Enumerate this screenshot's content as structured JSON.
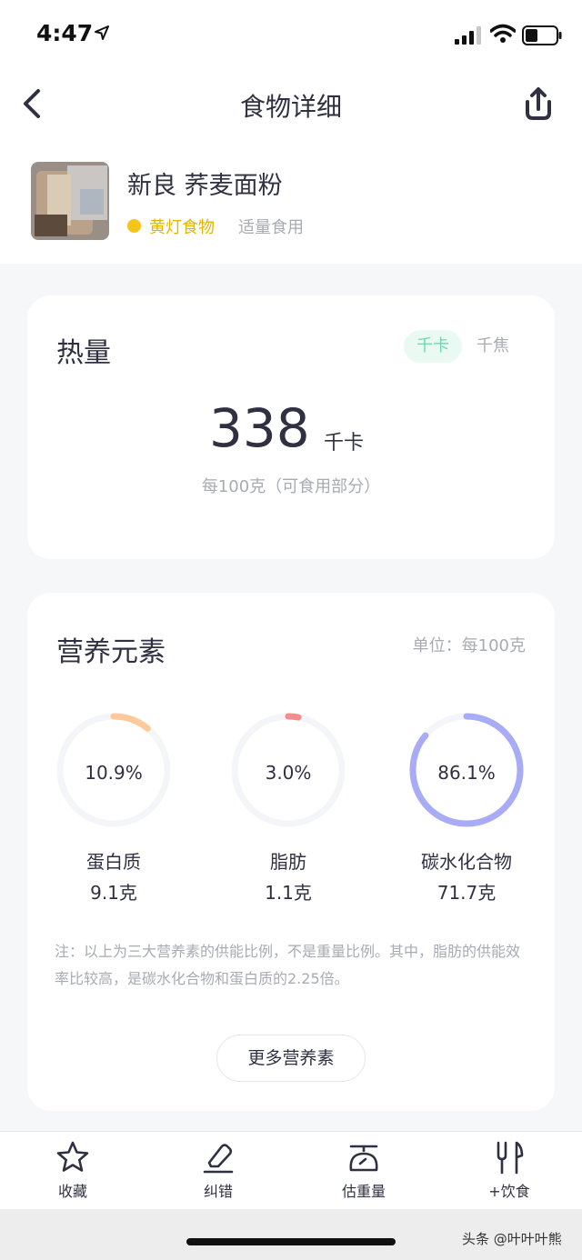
{
  "status": {
    "time": "4:47"
  },
  "nav": {
    "title": "食物详细"
  },
  "food": {
    "name": "新良 荞麦面粉",
    "light": "黄灯食物",
    "advice": "适量食用"
  },
  "energy": {
    "title": "热量",
    "unit_kcal": "千卡",
    "unit_kj": "千焦",
    "value": "338",
    "value_unit": "千卡",
    "basis": "每100克（可食用部分）"
  },
  "nutrients": {
    "title": "营养元素",
    "unit_note": "单位：每100克",
    "items": [
      {
        "name": "蛋白质",
        "percent": "10.9%",
        "amount": "9.1克",
        "fraction": 0.109,
        "color": "#ffc999"
      },
      {
        "name": "脂肪",
        "percent": "3.0%",
        "amount": "1.1克",
        "fraction": 0.03,
        "color": "#f48c8c"
      },
      {
        "name": "碳水化合物",
        "percent": "86.1%",
        "amount": "71.7克",
        "fraction": 0.861,
        "color": "#a8abf5"
      }
    ],
    "note": "注：以上为三大营养素的供能比例，不是重量比例。其中，脂肪的供能效率比较高，是碳水化合物和蛋白质的2.25倍。",
    "more_button": "更多营养素"
  },
  "tabs": [
    {
      "label": "收藏",
      "icon": "star-icon"
    },
    {
      "label": "纠错",
      "icon": "eraser-icon"
    },
    {
      "label": "估重量",
      "icon": "scale-icon"
    },
    {
      "label": "+饮食",
      "icon": "fork-knife-icon"
    }
  ],
  "watermark": "头条 @叶叶叶熊",
  "colors": {
    "accent": "#6fd7b2",
    "yellow_light": "#f5c518"
  }
}
